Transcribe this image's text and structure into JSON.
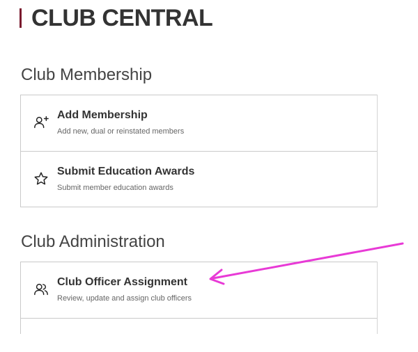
{
  "header": {
    "title": "CLUB CENTRAL",
    "accent_color": "#7a1a2e"
  },
  "sections": [
    {
      "title": "Club Membership",
      "items": [
        {
          "label": "Add Membership",
          "description": "Add new, dual or reinstated members",
          "icon": "add-user-icon"
        },
        {
          "label": "Submit Education Awards",
          "description": "Submit member education awards",
          "icon": "star-icon"
        }
      ]
    },
    {
      "title": "Club Administration",
      "items": [
        {
          "label": "Club Officer Assignment",
          "description": "Review, update and assign club officers",
          "icon": "users-icon"
        }
      ]
    }
  ],
  "annotation": {
    "type": "arrow",
    "color": "#e83ad6",
    "points_to": "Club Officer Assignment"
  }
}
